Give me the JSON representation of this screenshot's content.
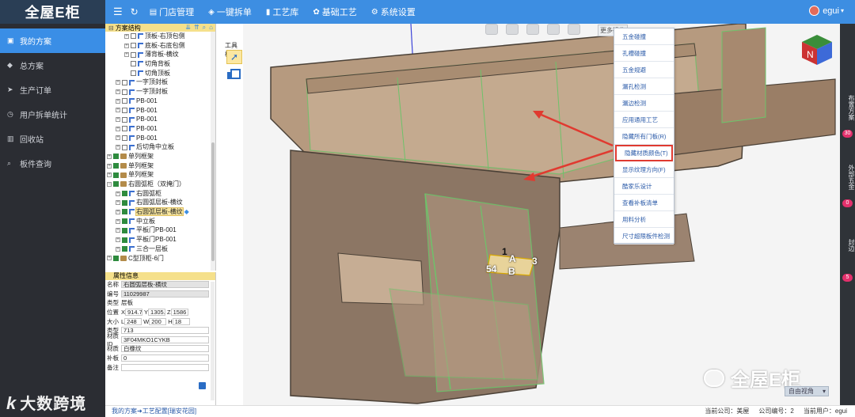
{
  "app": {
    "logo_text": "全屋E柜"
  },
  "nav": {
    "items": [
      {
        "label": "我的方案",
        "icon": "folder-icon",
        "active": true
      },
      {
        "label": "总方案",
        "icon": "diamond-icon"
      },
      {
        "label": "生产订单",
        "icon": "send-icon"
      },
      {
        "label": "用户拆单统计",
        "icon": "clock-icon"
      },
      {
        "label": "回收站",
        "icon": "trash-icon"
      },
      {
        "label": "板件查询",
        "icon": "search-icon"
      }
    ]
  },
  "topbar": {
    "items": [
      {
        "label": "门店管理",
        "icon": "store-icon"
      },
      {
        "label": "一键拆单",
        "icon": "shield-icon"
      },
      {
        "label": "工艺库",
        "icon": "bars-icon"
      },
      {
        "label": "基础工艺",
        "icon": "gear-icon"
      },
      {
        "label": "系统设置",
        "icon": "settings-icon"
      }
    ],
    "user": "egui"
  },
  "tree": {
    "header": "方案结构",
    "nodes": [
      {
        "label": "顶板-右顶包侧",
        "level": 3,
        "type": "part",
        "checked": false
      },
      {
        "label": "底板-右底包侧",
        "level": 3,
        "type": "part",
        "checked": false
      },
      {
        "label": "薄背板-横纹",
        "level": 3,
        "type": "part",
        "checked": false
      },
      {
        "label": "切角背板",
        "level": 3,
        "type": "part",
        "checked": false,
        "noexp": true
      },
      {
        "label": "切角顶板",
        "level": 3,
        "type": "part",
        "checked": false,
        "noexp": true
      },
      {
        "label": "一字顶封板",
        "level": 2,
        "type": "part",
        "checked": false
      },
      {
        "label": "一字顶封板",
        "level": 2,
        "type": "part",
        "checked": false
      },
      {
        "label": "PB-001",
        "level": 2,
        "type": "part",
        "checked": false
      },
      {
        "label": "PB-001",
        "level": 2,
        "type": "part",
        "checked": false
      },
      {
        "label": "PB-001",
        "level": 2,
        "type": "part",
        "checked": false
      },
      {
        "label": "PB-001",
        "level": 2,
        "type": "part",
        "checked": false
      },
      {
        "label": "PB-001",
        "level": 2,
        "type": "part",
        "checked": false
      },
      {
        "label": "后切角中立板",
        "level": 2,
        "type": "part",
        "checked": false
      },
      {
        "label": "单列框架",
        "level": 1,
        "type": "box",
        "checked": true
      },
      {
        "label": "单列框架",
        "level": 1,
        "type": "box",
        "checked": true
      },
      {
        "label": "单列框架",
        "level": 1,
        "type": "box",
        "checked": true
      },
      {
        "label": "右圆弧柜（双掩门）",
        "level": 1,
        "type": "box",
        "checked": true,
        "open": true
      },
      {
        "label": "右圆弧柜",
        "level": 2,
        "type": "part",
        "checked": true
      },
      {
        "label": "右圆弧层板-横纹",
        "level": 2,
        "type": "part",
        "checked": true
      },
      {
        "label": "右圆弧层板-横纹",
        "level": 2,
        "type": "part",
        "checked": true,
        "selected": true
      },
      {
        "label": "中立板",
        "level": 2,
        "type": "part",
        "checked": true
      },
      {
        "label": "平板门PB-001",
        "level": 2,
        "type": "part",
        "checked": true
      },
      {
        "label": "平板门PB-001",
        "level": 2,
        "type": "part",
        "checked": true
      },
      {
        "label": "三合一层板",
        "level": 2,
        "type": "part",
        "checked": true
      },
      {
        "label": "C型顶柜-6门",
        "level": 1,
        "type": "box",
        "checked": true
      }
    ]
  },
  "props": {
    "header": "属性信息",
    "name_label": "名称",
    "name": "右圆弧层板-横纹",
    "code_label": "编号",
    "code": "11029987",
    "type_label": "类型",
    "type": "层板",
    "pos_label": "位置",
    "pos_x": "914.72",
    "pos_y": "1305.2",
    "pos_z": "1586",
    "size_label": "大小",
    "size_l": "248",
    "size_w": "200",
    "size_h": "18",
    "type2_label": "类型",
    "type2": "713",
    "matid_label": "材质ID",
    "matid": "3F04MKO1CYKB",
    "mat_label": "材质",
    "mat": "白橡纹",
    "edge_label": "补板",
    "edge": "0",
    "note_label": "备注",
    "note": ""
  },
  "toolbar": {
    "label": "工具栏"
  },
  "viewport": {
    "more_label": "更多操作",
    "view_select": "自由视角",
    "dim_labels": [
      "1",
      "A",
      "3",
      "54",
      "B"
    ],
    "cube_letter": "N"
  },
  "context_menu": {
    "items": [
      "五金碰撞",
      "孔槽碰撞",
      "五金规避",
      "漏孔检测",
      "漏边检测",
      "应用通用工艺",
      "隐藏所有门板(R)",
      "隐藏材质颜色(T)",
      "显示纹理方向(F)",
      "酷家乐设计",
      "查看补板清单",
      "用料分析",
      "尺寸超限板件检测"
    ],
    "highlight_index": 7
  },
  "right_strip": {
    "items": [
      {
        "label": "布置方案",
        "count": "30"
      },
      {
        "label": "外部五金",
        "count": "0"
      },
      {
        "label": "封边",
        "count": "5"
      }
    ]
  },
  "status": {
    "breadcrumb": "我的方案➜工艺配置[瑞安花园]",
    "company_label": "当前公司：",
    "company": "美屋",
    "company_no_label": "公司编号：",
    "company_no": "2",
    "user_label": "当前用户：",
    "user": "egui"
  },
  "watermarks": {
    "left": "大数跨境",
    "left_mark": "k",
    "right": "全屋E柜"
  },
  "colors": {
    "accent": "#3d8ee2",
    "nav_bg": "#2b2d33",
    "highlight": "#e03a30",
    "badge": "#e4306c"
  }
}
